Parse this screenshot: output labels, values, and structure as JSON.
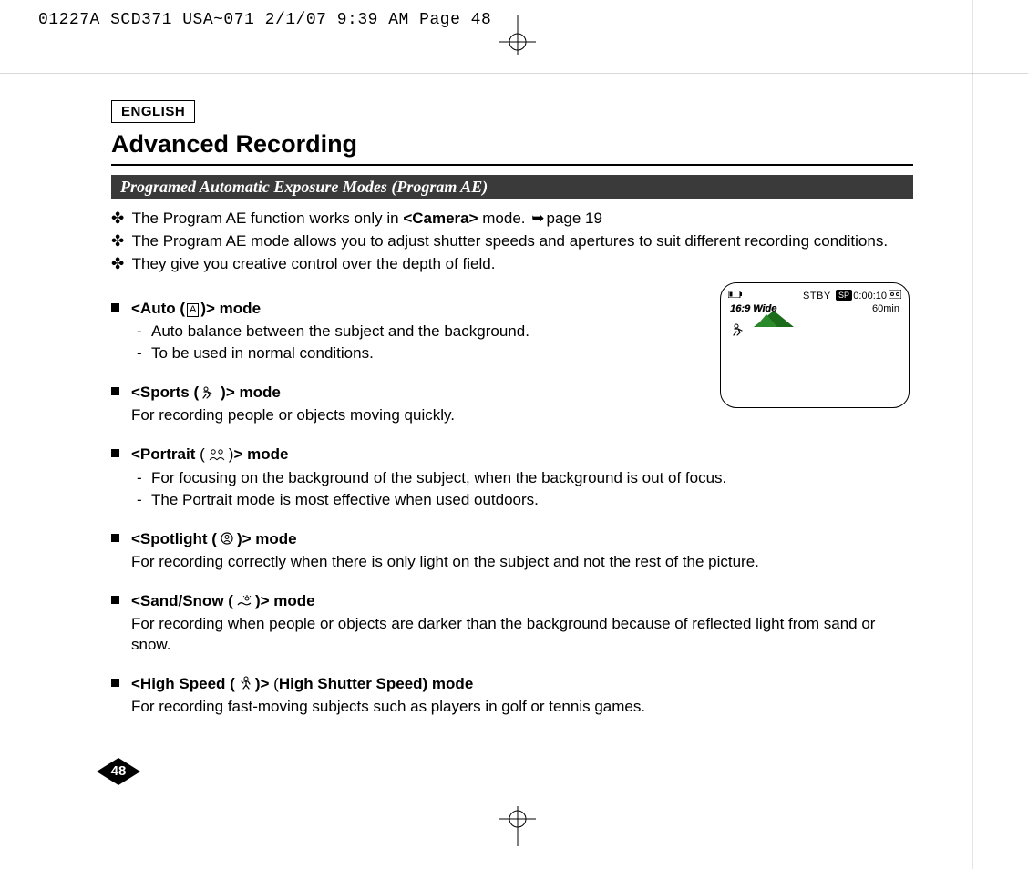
{
  "print_header": "01227A SCD371 USA~071  2/1/07 9:39 AM  Page 48",
  "language_label": "ENGLISH",
  "title": "Advanced Recording",
  "section_bar": "Programed Automatic Exposure Modes (Program AE)",
  "intro": {
    "l1a": "The Program AE function works only in ",
    "l1b": "<Camera>",
    "l1c": " mode. ",
    "l1d": "page 19",
    "l2": "The Program AE mode allows you to adjust shutter speeds and apertures to suit different recording conditions.",
    "l3": "They give you creative control over the depth of field."
  },
  "modes": {
    "auto": {
      "head_a": "<Auto (",
      "head_b": ")> mode",
      "icon_letter": "A",
      "s1": "Auto balance between the subject and the background.",
      "s2": "To be used in normal conditions."
    },
    "sports": {
      "head_a": "<Sports (",
      "head_b": ")> mode",
      "desc": "For recording people or objects moving quickly."
    },
    "portrait": {
      "head_a": "<Portrait",
      "head_mid": " (",
      "head_b": ")",
      "head_c": "> mode",
      "s1": "For focusing on the background of the subject, when the background is out of focus.",
      "s2": "The Portrait mode is most effective when used outdoors."
    },
    "spotlight": {
      "head_a": "<Spotlight (",
      "head_b": ")> mode",
      "desc": "For recording correctly when there is only light on the subject and not the rest of the picture."
    },
    "sandsnow": {
      "head_a": "<Sand/Snow (",
      "head_b": ")> mode",
      "desc": "For recording when people or objects are darker than the background because of reflected light from sand or snow."
    },
    "highspeed": {
      "head_a": "<High Speed (",
      "head_b": ")>",
      "head_mid": " (",
      "head_c": "High Shutter Speed) mode",
      "desc": "For recording fast-moving subjects such as players in golf or tennis games."
    }
  },
  "screen": {
    "stby": "STBY",
    "sp": "SP",
    "timecode": "0:00:10",
    "remaining": "60min",
    "wide": "16:9 Wide"
  },
  "page_number": "48"
}
